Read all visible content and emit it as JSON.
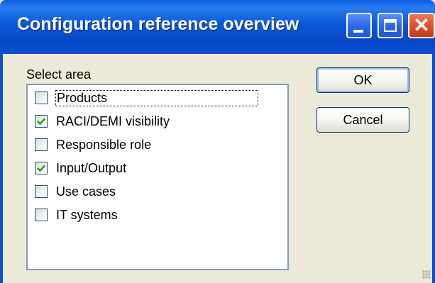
{
  "window": {
    "title": "Configuration reference overview"
  },
  "select_area": {
    "label": "Select area",
    "items": [
      {
        "label": "Products",
        "checked": false,
        "focused": true
      },
      {
        "label": "RACI/DEMI visibility",
        "checked": true
      },
      {
        "label": "Responsible role",
        "checked": false
      },
      {
        "label": "Input/Output",
        "checked": true
      },
      {
        "label": "Use cases",
        "checked": false
      },
      {
        "label": "IT systems",
        "checked": false
      }
    ]
  },
  "buttons": {
    "ok": "OK",
    "cancel": "Cancel"
  },
  "colors": {
    "titlebar": "#0a4fd0",
    "check": "#21a121",
    "close": "#d8502c"
  }
}
